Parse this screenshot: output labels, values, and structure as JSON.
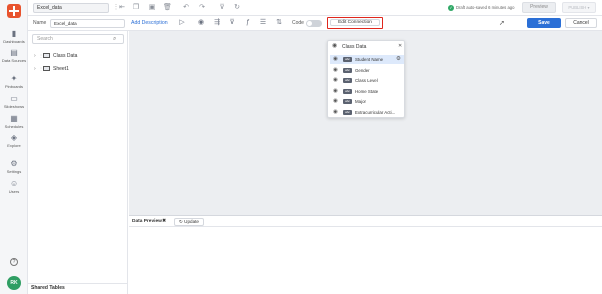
{
  "nav": {
    "items": [
      {
        "label": "Dashboards",
        "icon": "bar-chart-icon"
      },
      {
        "label": "Data Sources",
        "icon": "database-icon"
      },
      {
        "label": "Pinboards",
        "icon": "pin-icon"
      },
      {
        "label": "Slideshows",
        "icon": "folder-icon"
      },
      {
        "label": "Schedules",
        "icon": "calendar-icon"
      },
      {
        "label": "Explore",
        "icon": "explore-icon"
      },
      {
        "label": "Settings",
        "icon": "gear-icon"
      },
      {
        "label": "Users",
        "icon": "users-icon"
      }
    ],
    "avatar_initials": "RK"
  },
  "topbar": {
    "file_name": "Excel_data",
    "draft_status": "Draft auto-saved 6 minutes ago",
    "preview_label": "Preview",
    "publish_label": "PUBLISH"
  },
  "toolbar": {
    "name_label": "Name",
    "name_value": "Excel_data",
    "add_description": "Add Description",
    "code_label": "Code",
    "edit_connection": "Edit Connection",
    "save_label": "Save",
    "cancel_label": "Cancel"
  },
  "leftpanel": {
    "search_placeholder": "Search",
    "tree": [
      {
        "label": "Class Data"
      },
      {
        "label": "Sheet1"
      }
    ],
    "shared_tables": "Shared Tables"
  },
  "popup": {
    "title": "Class Data",
    "fields": [
      {
        "label": "Student Name",
        "type_badge": "abc",
        "selected": true
      },
      {
        "label": "Gender",
        "type_badge": "abc",
        "selected": false
      },
      {
        "label": "Class Level",
        "type_badge": "abc",
        "selected": false
      },
      {
        "label": "Home State",
        "type_badge": "abc",
        "selected": false
      },
      {
        "label": "Major",
        "type_badge": "abc",
        "selected": false
      },
      {
        "label": "Extracurricular Acti...",
        "type_badge": "abc",
        "selected": false
      }
    ]
  },
  "data_preview": {
    "title": "Data Preview",
    "update_label": "Update"
  },
  "colors": {
    "accent": "#2b6fd6",
    "brand": "#e8532e",
    "highlight_border": "#e0271d",
    "success": "#2fa866"
  }
}
